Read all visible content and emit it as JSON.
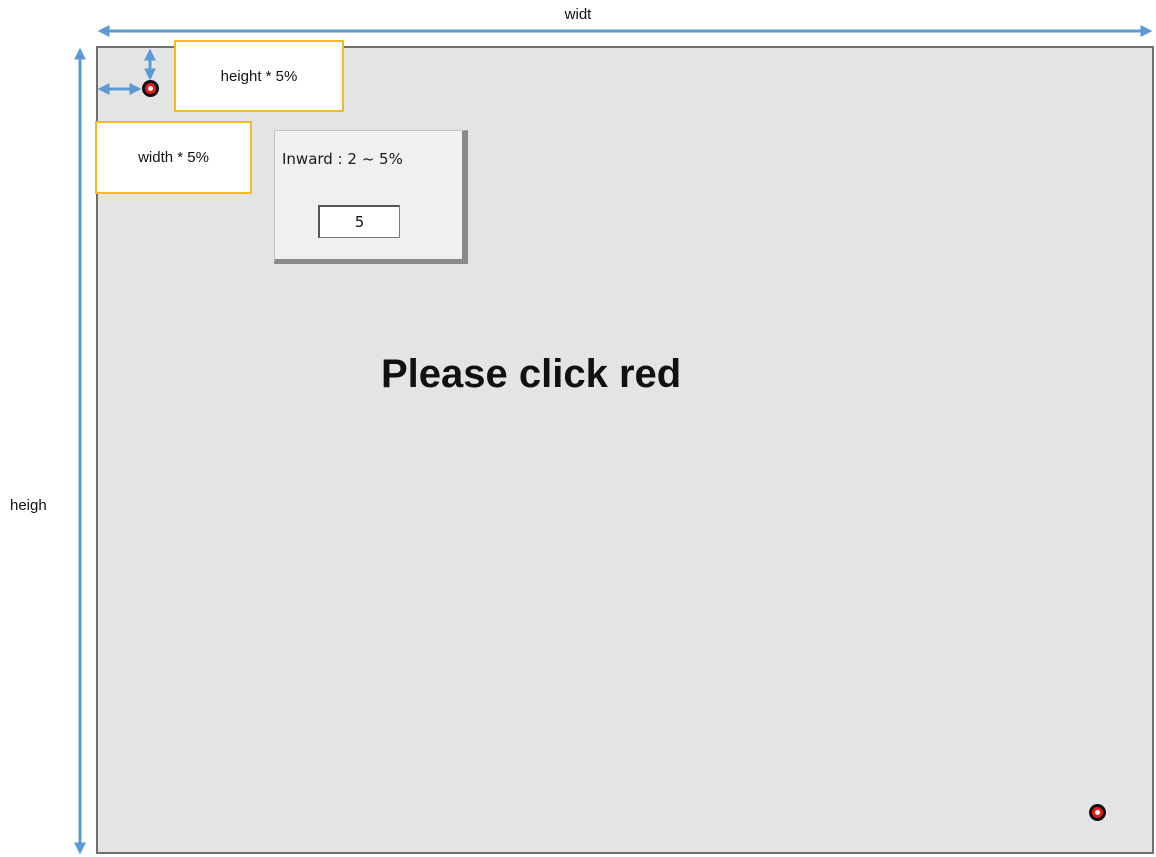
{
  "labels": {
    "width": "widt",
    "height": "heigh"
  },
  "notes": {
    "height_offset": "height * 5%",
    "width_offset": "width * 5%"
  },
  "panel": {
    "label": "Inward : 2 ~ 5%",
    "value": "5"
  },
  "instruction": "Please click red",
  "colors": {
    "arrow": "#5b9bd5",
    "note_border": "#f2bd23",
    "target_red": "#e21a1a",
    "screen_bg": "#e4e4e4"
  }
}
